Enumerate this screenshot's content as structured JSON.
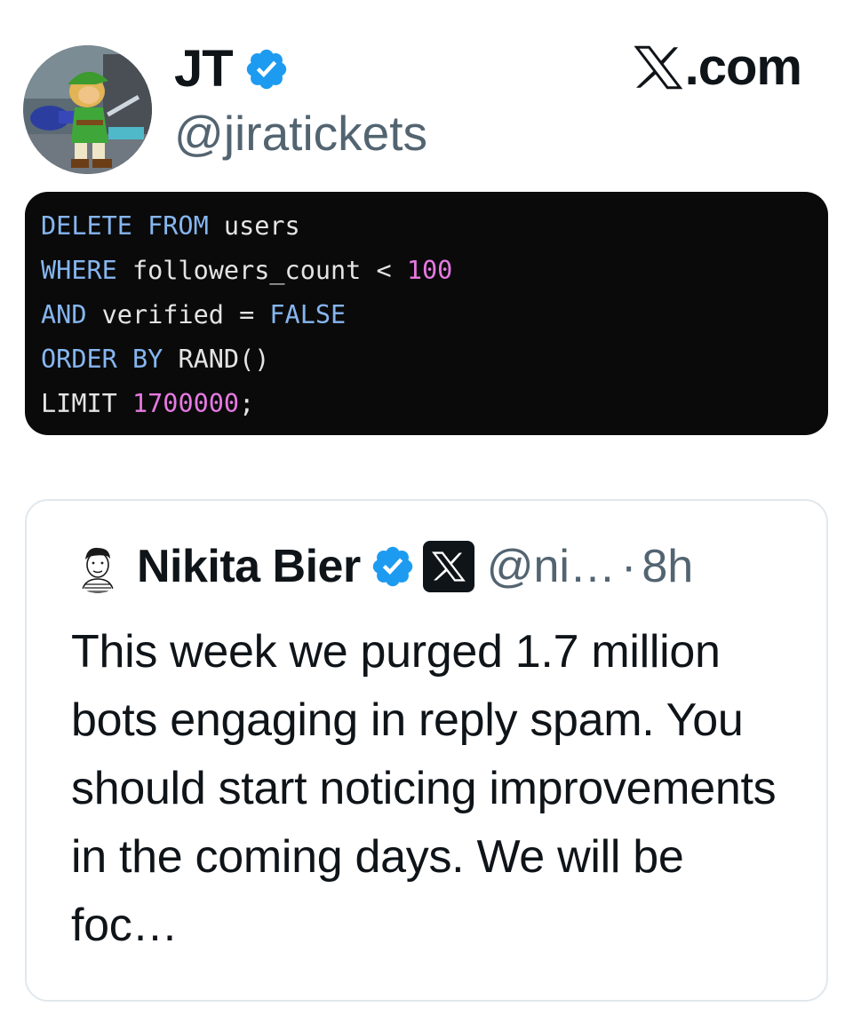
{
  "author": {
    "display_name": "JT",
    "handle": "@jiratickets",
    "verified": true,
    "avatar_icon": "zelda-link-avatar-icon"
  },
  "brand": {
    "label": ".com",
    "logo_icon": "x-logo-icon"
  },
  "code": {
    "lines": [
      [
        {
          "t": "DELETE FROM",
          "c": "kw"
        },
        {
          "t": " users",
          "c": "txt"
        }
      ],
      [
        {
          "t": "WHERE",
          "c": "kw"
        },
        {
          "t": " followers_count < ",
          "c": "txt"
        },
        {
          "t": "100",
          "c": "num"
        }
      ],
      [
        {
          "t": "AND",
          "c": "kw"
        },
        {
          "t": " verified = ",
          "c": "txt"
        },
        {
          "t": "FALSE",
          "c": "kw"
        }
      ],
      [
        {
          "t": "ORDER BY",
          "c": "kw"
        },
        {
          "t": " RAND()",
          "c": "txt"
        }
      ],
      [
        {
          "t": "LIMIT",
          "c": "txt"
        },
        {
          "t": " ",
          "c": "txt"
        },
        {
          "t": "1700000",
          "c": "num"
        },
        {
          "t": ";",
          "c": "txt"
        }
      ]
    ],
    "colors": {
      "keyword": "#86b6f0",
      "number": "#e679e2",
      "text": "#e4e4e4",
      "background": "#0a0a0a"
    }
  },
  "quote": {
    "display_name": "Nikita Bier",
    "verified": true,
    "affiliate_badge_icon": "x-affiliate-badge-icon",
    "handle": "@ni…",
    "separator": "·",
    "time": "8h",
    "body": "This week we purged 1.7 million bots engaging in reply spam. You should start noticing improvements in the coming days. We will be foc…"
  },
  "colors": {
    "verified_blue": "#1d9bf0",
    "muted_text": "#536471",
    "primary_text": "#0f1419",
    "card_border": "#e1e8ed"
  }
}
